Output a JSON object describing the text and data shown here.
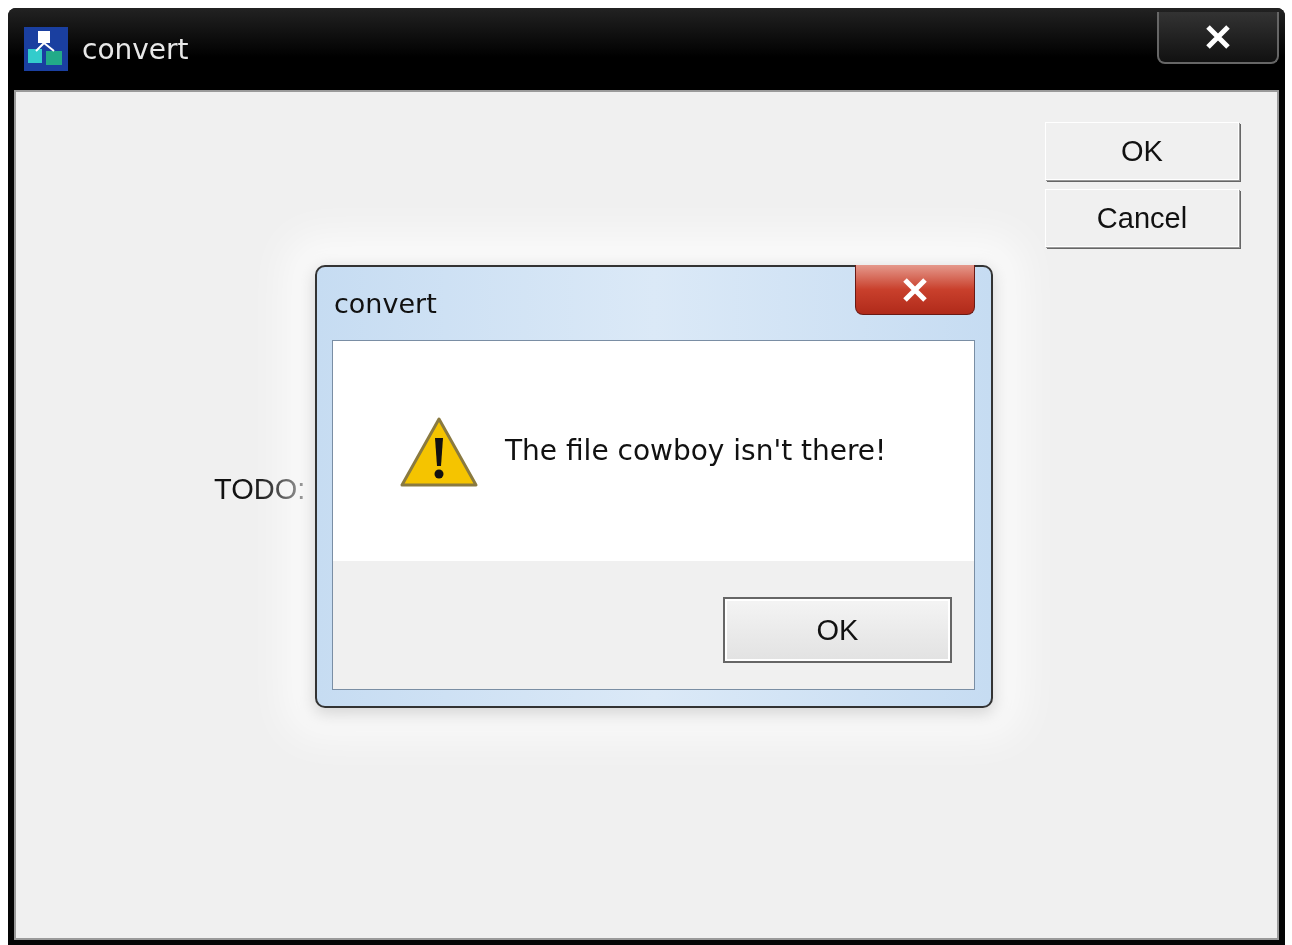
{
  "main_window": {
    "title": "convert",
    "buttons": [
      {
        "label": "OK"
      },
      {
        "label": "Cancel"
      }
    ],
    "label": "TODO:"
  },
  "dialog": {
    "title": "convert",
    "message": "The file cowboy isn't there!",
    "buttons": [
      {
        "label": "OK"
      }
    ]
  }
}
